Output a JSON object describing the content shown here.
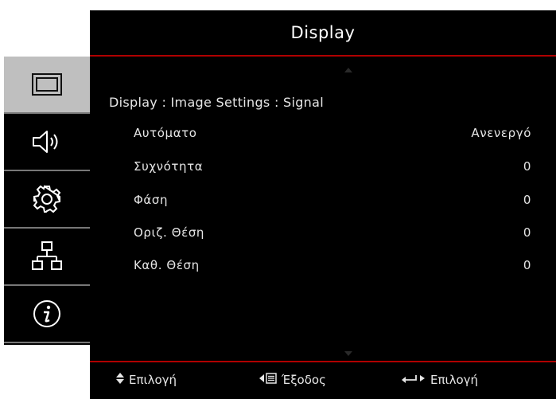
{
  "title": "Display",
  "breadcrumb": "Display : Image Settings : Signal",
  "menu": {
    "items": [
      {
        "label": "Αυτόματο",
        "value": "Ανενεργό"
      },
      {
        "label": "Συχνότητα",
        "value": "0"
      },
      {
        "label": "Φάση",
        "value": "0"
      },
      {
        "label": "Οριζ. Θέση",
        "value": "0"
      },
      {
        "label": "Καθ. Θέση",
        "value": "0"
      }
    ]
  },
  "sidebar": {
    "items": [
      {
        "icon": "display-icon",
        "active": true
      },
      {
        "icon": "speaker-icon",
        "active": false
      },
      {
        "icon": "gear-icon",
        "active": false
      },
      {
        "icon": "network-icon",
        "active": false
      },
      {
        "icon": "info-icon",
        "active": false
      }
    ]
  },
  "footer": {
    "select_label": "Επιλογή",
    "exit_label": "Έξοδος",
    "enter_label": "Επιλογή"
  },
  "colors": {
    "background": "#000000",
    "accent_line": "#b00000",
    "text": "#e6e6e6",
    "sidebar_active": "#bfbfbf",
    "sidebar_divider": "#777777"
  }
}
